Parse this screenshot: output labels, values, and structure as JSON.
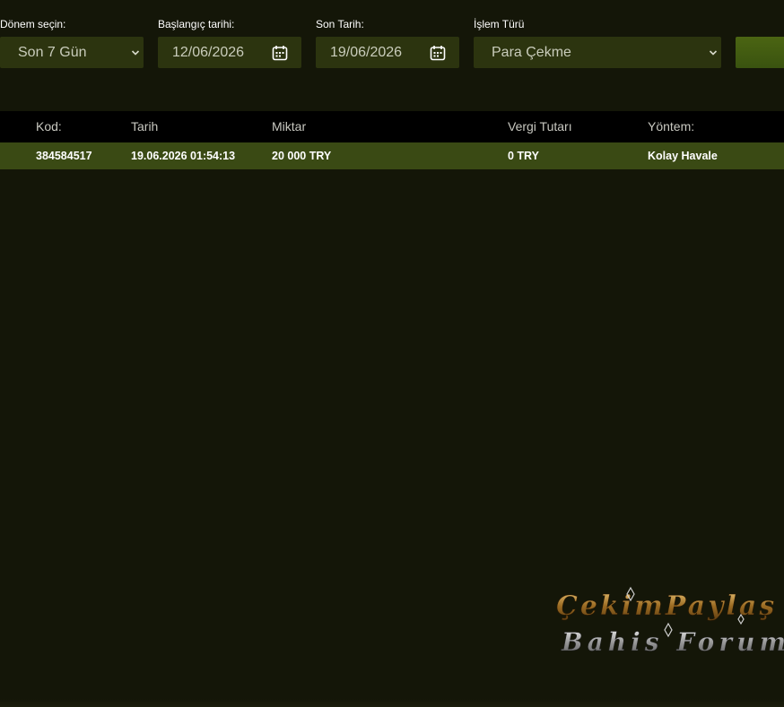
{
  "filters": {
    "period": {
      "label": "Dönem seçin:",
      "value": "Son 7 Gün"
    },
    "start_date": {
      "label": "Başlangıç tarihi:",
      "value": "12/06/2026"
    },
    "end_date": {
      "label": "Son Tarih:",
      "value": "19/06/2026"
    },
    "type": {
      "label": "İşlem Türü",
      "value": "Para Çekme"
    }
  },
  "table": {
    "headers": [
      "Kod:",
      "Tarih",
      "Miktar",
      "Vergi Tutarı",
      "Yöntem:"
    ],
    "rows": [
      [
        "384584517",
        "19.06.2026 01:54:13",
        "20 000 TRY",
        "0 TRY",
        "Kolay Havale"
      ]
    ]
  },
  "watermark": {
    "line1": "ÇekimPaylaş",
    "line2": "Bahis Forum"
  },
  "colors": {
    "background": "#141608",
    "control": "#2c340f",
    "row_highlight": "#3a4a14",
    "header_bg": "#000000",
    "accent": "#4b6512"
  }
}
